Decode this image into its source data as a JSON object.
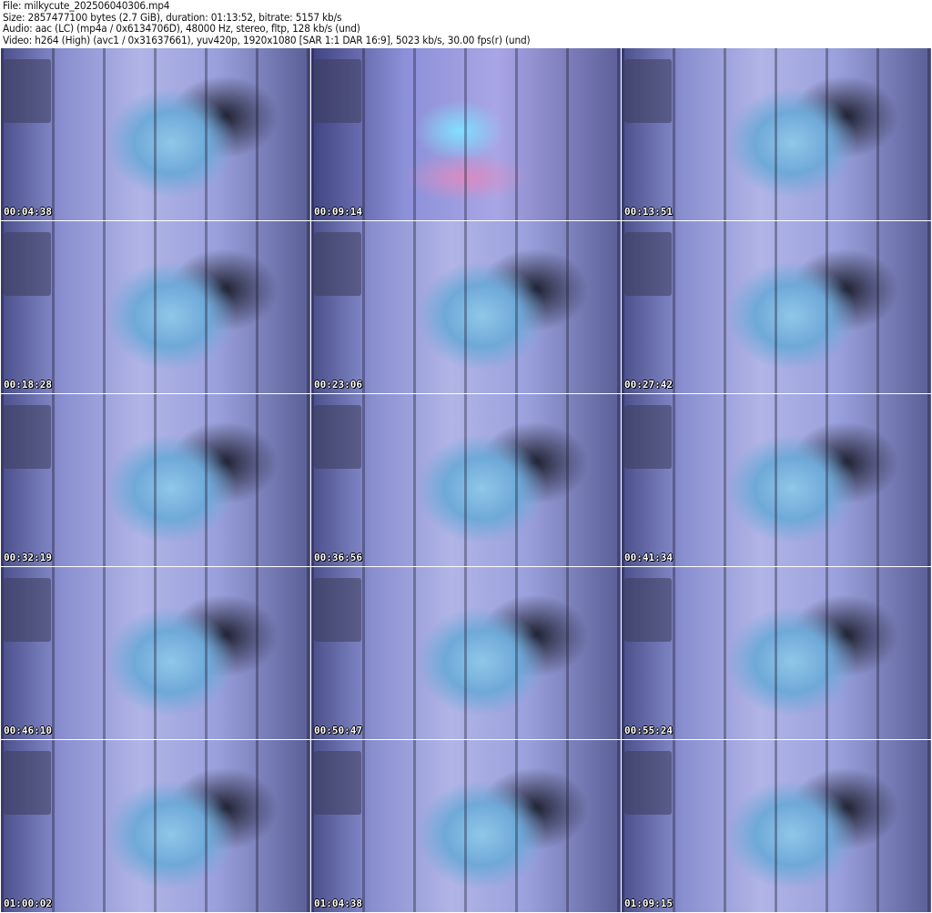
{
  "header": {
    "file": "File: milkycute_202506040306.mp4",
    "size": "Size: 2857477100 bytes (2.7 GiB), duration: 01:13:52, bitrate: 5157 kb/s",
    "audio": "Audio: aac (LC) (mp4a / 0x6134706D), 48000 Hz, stereo, fltp, 128 kb/s (und)",
    "video": "Video: h264 (High) (avc1 / 0x31637661), yuv420p, 1920x1080 [SAR 1:1 DAR 16:9], 5023 kb/s, 30.00 fps(r) (und)"
  },
  "thumbnails": [
    {
      "timestamp": "00:04:38"
    },
    {
      "timestamp": "00:09:14"
    },
    {
      "timestamp": "00:13:51"
    },
    {
      "timestamp": "00:18:28"
    },
    {
      "timestamp": "00:23:06"
    },
    {
      "timestamp": "00:27:42"
    },
    {
      "timestamp": "00:32:19"
    },
    {
      "timestamp": "00:36:56"
    },
    {
      "timestamp": "00:41:34"
    },
    {
      "timestamp": "00:46:10"
    },
    {
      "timestamp": "00:50:47"
    },
    {
      "timestamp": "00:55:24"
    },
    {
      "timestamp": "01:00:02"
    },
    {
      "timestamp": "01:04:38"
    },
    {
      "timestamp": "01:09:15"
    }
  ]
}
